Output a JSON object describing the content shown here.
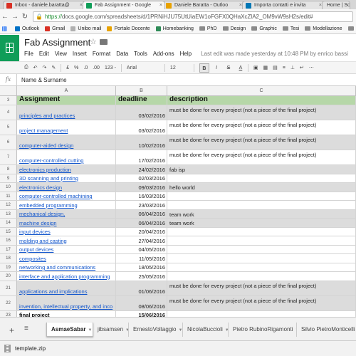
{
  "browser": {
    "tabs": [
      {
        "label": "Inbox - daniele.baratta@",
        "favicon_color": "#d93025",
        "icon": "gmail-icon"
      },
      {
        "label": "Fab Assignment - Google",
        "favicon_color": "#0f9d58",
        "icon": "sheets-icon"
      },
      {
        "label": "Daniele Baratta - Outloo",
        "favicon_color": "#e8a200",
        "icon": "outlook-icon"
      },
      {
        "label": "Importa contatti e invita",
        "favicon_color": "#0077b5",
        "icon": "linkedin-icon"
      },
      {
        "label": "Home | Sc",
        "favicon_color": "#9e9e9e",
        "icon": "page-icon"
      }
    ],
    "url_scheme": "https://",
    "url_rest": "docs.google.com/spreadsheets/d/1PRNiHJU75UtUiaEW1oFGFX0QHaXcZlA2_OM9vW9sH2s/edit#",
    "bookmarks": [
      {
        "label": "Outlook",
        "color": "#0072c6",
        "type": "icon"
      },
      {
        "label": "Gmail",
        "color": "#d93025",
        "type": "icon"
      },
      {
        "label": "Unibo mail",
        "color": "#b0b0b0",
        "type": "icon"
      },
      {
        "label": "Portale Docente",
        "color": "#e8a200",
        "type": "icon"
      },
      {
        "label": "Homebanking",
        "color": "#2e8b57",
        "type": "icon"
      },
      {
        "label": "PhD",
        "type": "folder"
      },
      {
        "label": "Design",
        "type": "folder"
      },
      {
        "label": "Graphic",
        "type": "folder"
      },
      {
        "label": "Tesi",
        "type": "folder"
      },
      {
        "label": "Modellazione",
        "type": "folder"
      },
      {
        "label": "Inn",
        "type": "folder"
      }
    ]
  },
  "sheets": {
    "title": "Fab Assignment",
    "menu": [
      "File",
      "Edit",
      "View",
      "Insert",
      "Format",
      "Data",
      "Tools",
      "Add-ons",
      "Help"
    ],
    "last_edit": "Last edit was made yesterday at 10:48 PM by enrico bassi",
    "toolbar": {
      "currency": "£",
      "percent": "%",
      "dec_less": ".0",
      "dec_more": ".00",
      "number_format": "123 -",
      "font": "Arial",
      "font_size": "12",
      "bold": "B",
      "italic": "I",
      "strike": "S",
      "text_color": "A"
    },
    "formula_bar": {
      "fx": "fx",
      "value": "Name & Surname"
    },
    "columns": [
      "A",
      "B",
      "C"
    ],
    "rows": [
      {
        "n": "3",
        "a": "Assignment",
        "b": "deadline",
        "c": "description",
        "style": "hdr",
        "h": 13
      },
      {
        "n": "4",
        "a": "principles and practices",
        "b": "03/02/2016",
        "c": "must be done for every project (not a piece of the final project)",
        "style": "alt",
        "h": 21
      },
      {
        "n": "5",
        "a": "project management",
        "b": "03/02/2016",
        "c": "must be done for every project (not a piece of the final project)",
        "style": "",
        "h": 21
      },
      {
        "n": "6",
        "a": "computer-aided design",
        "b": "10/02/2016",
        "c": "must be done for every project (not a piece of the final project)",
        "style": "alt",
        "h": 21
      },
      {
        "n": "7",
        "a": "computer-controlled cutting",
        "b": "17/02/2016",
        "c": "must be done for every project (not a piece of the final project)",
        "style": "",
        "h": 21
      },
      {
        "n": "8",
        "a": "electronics production",
        "b": "24/02/2016",
        "c": "fab isp",
        "style": "alt",
        "h": 12.5
      },
      {
        "n": "9",
        "a": "3D scanning and printing",
        "b": "02/03/2016",
        "c": "",
        "style": "",
        "h": 12.5
      },
      {
        "n": "10",
        "a": "electronics design",
        "b": "09/03/2016",
        "c": "hello world",
        "style": "alt",
        "h": 12.5
      },
      {
        "n": "11",
        "a": "computer-controlled machining",
        "b": "16/03/2016",
        "c": "",
        "style": "",
        "h": 12.5
      },
      {
        "n": "12",
        "a": "embedded programming",
        "b": "23/03/2016",
        "c": "",
        "style": "",
        "h": 12.5
      },
      {
        "n": "13",
        "a": "mechanical design,",
        "b": "06/04/2016",
        "c": "team work",
        "style": "alt",
        "h": 12.5
      },
      {
        "n": "14",
        "a": "machine design",
        "b": "06/04/2016",
        "c": "team work",
        "style": "alt",
        "h": 12.5
      },
      {
        "n": "15",
        "a": "input devices",
        "b": "20/04/2016",
        "c": "",
        "style": "",
        "h": 12.5
      },
      {
        "n": "16",
        "a": "molding and casting",
        "b": "27/04/2016",
        "c": "",
        "style": "",
        "h": 12.5
      },
      {
        "n": "17",
        "a": "output devices",
        "b": "04/05/2016",
        "c": "",
        "style": "",
        "h": 12.5
      },
      {
        "n": "18",
        "a": "composites",
        "b": "11/05/2016",
        "c": "",
        "style": "",
        "h": 12.5
      },
      {
        "n": "19",
        "a": "networking and communications",
        "b": "18/05/2016",
        "c": "",
        "style": "",
        "h": 12.5
      },
      {
        "n": "20",
        "a": "interface and application programming",
        "b": "25/05/2016",
        "c": "",
        "style": "",
        "h": 12.5
      },
      {
        "n": "21",
        "a": "applications and implications",
        "b": "01/06/2016",
        "c": "must be done for every project (not a piece of the final project)",
        "style": "alt",
        "h": 21
      },
      {
        "n": "22",
        "a": "invention, intellectual property, and inco",
        "b": "08/06/2016",
        "c": "must be done for every project (not a piece of the final project)",
        "style": "alt",
        "h": 21
      },
      {
        "n": "23",
        "a": "final project",
        "b": "15/06/2016",
        "c": "",
        "style": "final",
        "h": 12.5
      }
    ],
    "sheet_tabs": [
      "AsmaeSabar",
      "jibsamsen",
      "ErnestoVoltaggio",
      "NicolaBuccioli",
      "Pietro RubinoRigamonti",
      "Silvio PietroMonticelli"
    ],
    "active_sheet": 0
  },
  "download": {
    "filename": "template.zip"
  }
}
